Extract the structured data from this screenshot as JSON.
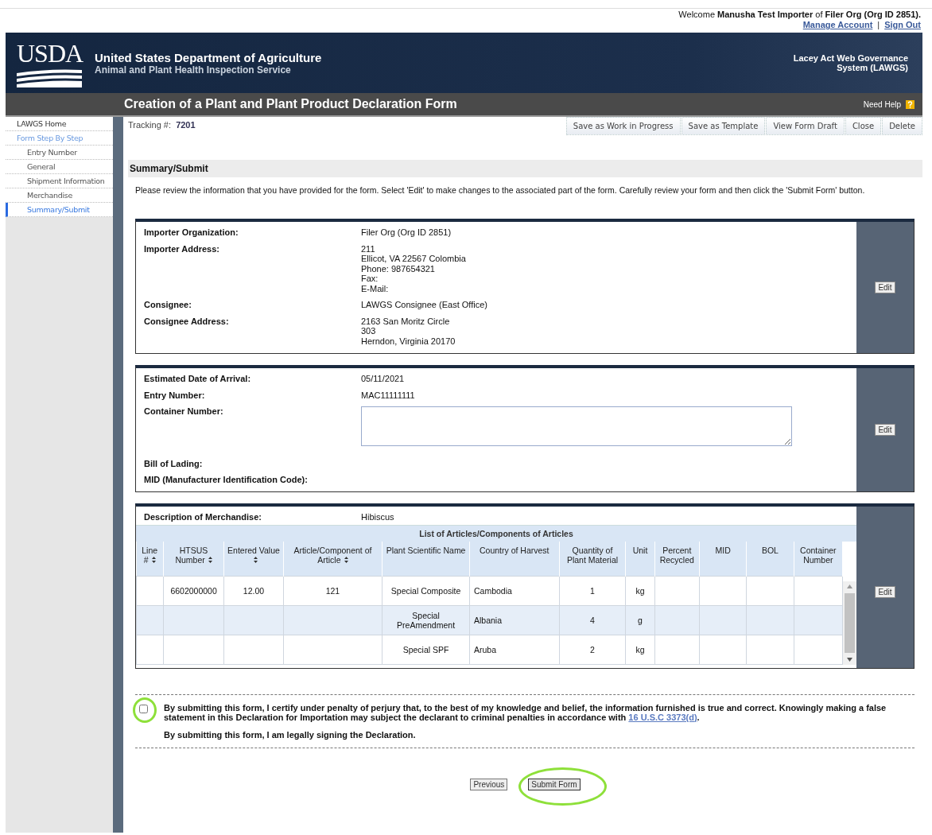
{
  "topbar": {
    "welcome_prefix": "Welcome",
    "user": "Manusha Test Importer",
    "welcome_mid": "of",
    "org": "Filer Org (Org ID 2851).",
    "links": [
      "Manage Account",
      "Sign Out"
    ],
    "separator": "|"
  },
  "banner": {
    "logo": "USDA",
    "agency": "United States Department of Agriculture",
    "service": "Animal and Plant Health Inspection Service",
    "system": "Lacey Act Web Governance System (LAWGS)"
  },
  "title_bar": {
    "title": "Creation of a Plant and Plant Product Declaration Form",
    "help": "Need Help"
  },
  "sidebar": {
    "home": "LAWGS Home",
    "section": "Form Step By Step",
    "items": [
      {
        "label": "Entry Number",
        "selected": false
      },
      {
        "label": "General",
        "selected": false
      },
      {
        "label": "Shipment Information",
        "selected": false
      },
      {
        "label": "Merchandise",
        "selected": false
      },
      {
        "label": "Summary/Submit",
        "selected": true
      }
    ]
  },
  "tracking": {
    "label": "Tracking #:",
    "value": "7201"
  },
  "toolbar": [
    "Save as Work in Progress",
    "Save as Template",
    "View Form Draft",
    "Close",
    "Delete"
  ],
  "section_title": "Summary/Submit",
  "intro": "Please review the information that you have provided for the form. Select 'Edit' to make changes to the associated part of the form. Carefully review your form and then click the 'Submit Form' button.",
  "cards": [
    {
      "kind": "fields",
      "edit": "Edit",
      "rows": [
        {
          "label": "Importer Organization:",
          "value": "Filer Org (Org ID 2851)",
          "kind": "text"
        },
        {
          "label": "Importer Address:",
          "value": "211\nEllicot, VA 22567 Colombia\nPhone: 987654321\nFax:\nE-Mail:",
          "kind": "text"
        },
        {
          "label": "Consignee:",
          "value": "LAWGS Consignee (East Office)",
          "kind": "text"
        },
        {
          "label": "Consignee Address:",
          "value": "2163 San Moritz Circle\n303\nHerndon, Virginia 20170",
          "kind": "text"
        }
      ]
    },
    {
      "kind": "fields",
      "edit": "Edit",
      "rows": [
        {
          "label": "Estimated Date of Arrival:",
          "value": "05/11/2021",
          "kind": "text"
        },
        {
          "label": "Entry Number:",
          "value": "MAC11111111",
          "kind": "text"
        },
        {
          "label": "Container Number:",
          "kind": "textarea"
        },
        {
          "label": "Bill of Lading:",
          "kind": "text"
        },
        {
          "label": "MID (Manufacturer Identification Code):",
          "kind": "text"
        }
      ]
    },
    {
      "kind": "table",
      "edit": "Edit",
      "description": {
        "label": "Description of Merchandise:",
        "value": "Hibiscus"
      },
      "table": {
        "caption": "List of Articles/Components of Articles",
        "columns": [
          {
            "label": "Line #",
            "sortable": true
          },
          {
            "label": "HTSUS Number",
            "sortable": true
          },
          {
            "label": "Entered Value",
            "sortable": true
          },
          {
            "label": "Article/Component of Article",
            "sortable": true
          },
          {
            "label": "Plant Scientific Name",
            "sortable": false
          },
          {
            "label": "Country of Harvest",
            "sortable": false
          },
          {
            "label": "Quantity of Plant Material",
            "sortable": false
          },
          {
            "label": "Unit",
            "sortable": false
          },
          {
            "label": "Percent Recycled",
            "sortable": false
          },
          {
            "label": "MID",
            "sortable": false
          },
          {
            "label": "BOL",
            "sortable": false
          },
          {
            "label": "Container Number",
            "sortable": false
          }
        ],
        "rows": [
          [
            null,
            "6602000000",
            "12.00",
            "121",
            "Special Composite",
            "Cambodia",
            "1",
            "kg",
            null,
            null,
            null,
            null
          ],
          [
            null,
            null,
            null,
            null,
            "Special PreAmendment",
            "Albania",
            "4",
            "g",
            null,
            null,
            null,
            null
          ],
          [
            null,
            null,
            null,
            null,
            "Special SPF",
            "Aruba",
            "2",
            "kg",
            null,
            null,
            null,
            null
          ]
        ]
      }
    }
  ],
  "certification": {
    "checked": false,
    "statement": "By submitting this form, I certify under penalty of perjury that, to the best of my knowledge and belief, the information furnished is true and correct. Knowingly making a false statement in this Declaration for Importation may subject the declarant to criminal penalties in accordance with",
    "link": "16 U.S.C 3373(d)",
    "end": ".",
    "signing": "By submitting this form, I am legally signing the Declaration."
  },
  "buttons": [
    {
      "label": "Previous",
      "highlighted": false
    },
    {
      "label": "Submit Form",
      "highlighted": true
    }
  ]
}
